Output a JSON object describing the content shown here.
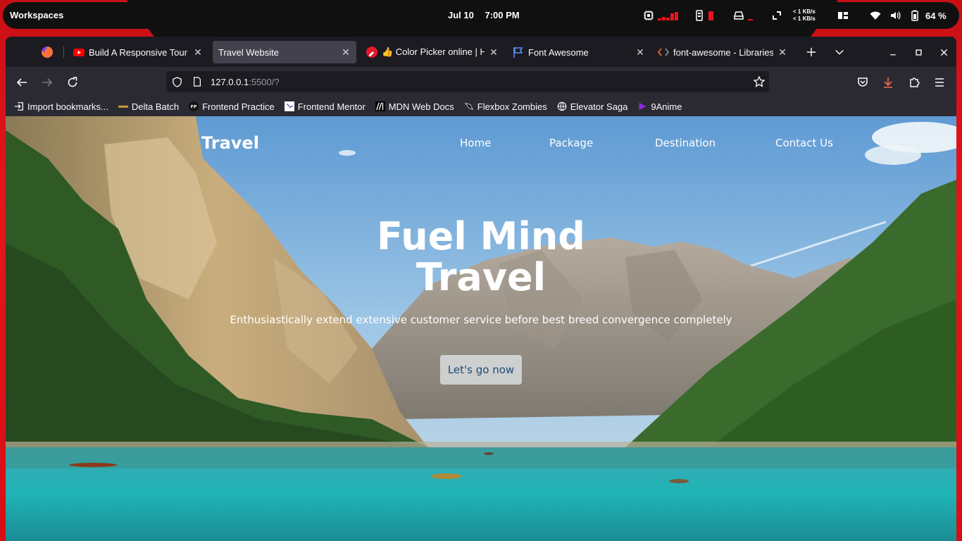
{
  "topbar": {
    "workspaces_label": "Workspaces",
    "date": "Jul 10",
    "time": "7:00 PM",
    "net_up": "< 1 KB/s",
    "net_down": "< 1 KB/s",
    "battery": "64 %",
    "accent": "#e8141c"
  },
  "browser": {
    "tabs": [
      {
        "title": "Build A Responsive Tour",
        "icon": "youtube-icon",
        "active": false
      },
      {
        "title": "Travel Website",
        "icon": "",
        "active": true
      },
      {
        "title": "👍 Color Picker online | H",
        "icon": "color-picker-icon",
        "active": false
      },
      {
        "title": "Font Awesome",
        "icon": "flag-icon",
        "active": false
      },
      {
        "title": "font-awesome - Libraries",
        "icon": "code-icon",
        "active": false
      }
    ],
    "url_host": "127.0.0.1",
    "url_rest": ":5500/?",
    "bookmarks": [
      {
        "label": "Import bookmarks...",
        "icon": "import-icon"
      },
      {
        "label": "Delta Batch",
        "icon": "delta-batch-icon"
      },
      {
        "label": "Frontend Practice",
        "icon": "fp-icon"
      },
      {
        "label": "Frontend Mentor",
        "icon": "frontend-mentor-icon"
      },
      {
        "label": "MDN Web Docs",
        "icon": "mdn-icon"
      },
      {
        "label": "Flexbox Zombies",
        "icon": "flexbox-zombies-icon"
      },
      {
        "label": "Elevator Saga",
        "icon": "globe-icon"
      },
      {
        "label": "9Anime",
        "icon": "9anime-icon"
      }
    ]
  },
  "site": {
    "logo": "Travel",
    "nav": [
      "Home",
      "Package",
      "Destination",
      "Contact Us"
    ],
    "hero_line1": "Fuel Mind",
    "hero_line2": "Travel",
    "subtitle": "Enthusiastically extend extensive customer service before best breed convergence completely",
    "cta": "Let's go now"
  }
}
